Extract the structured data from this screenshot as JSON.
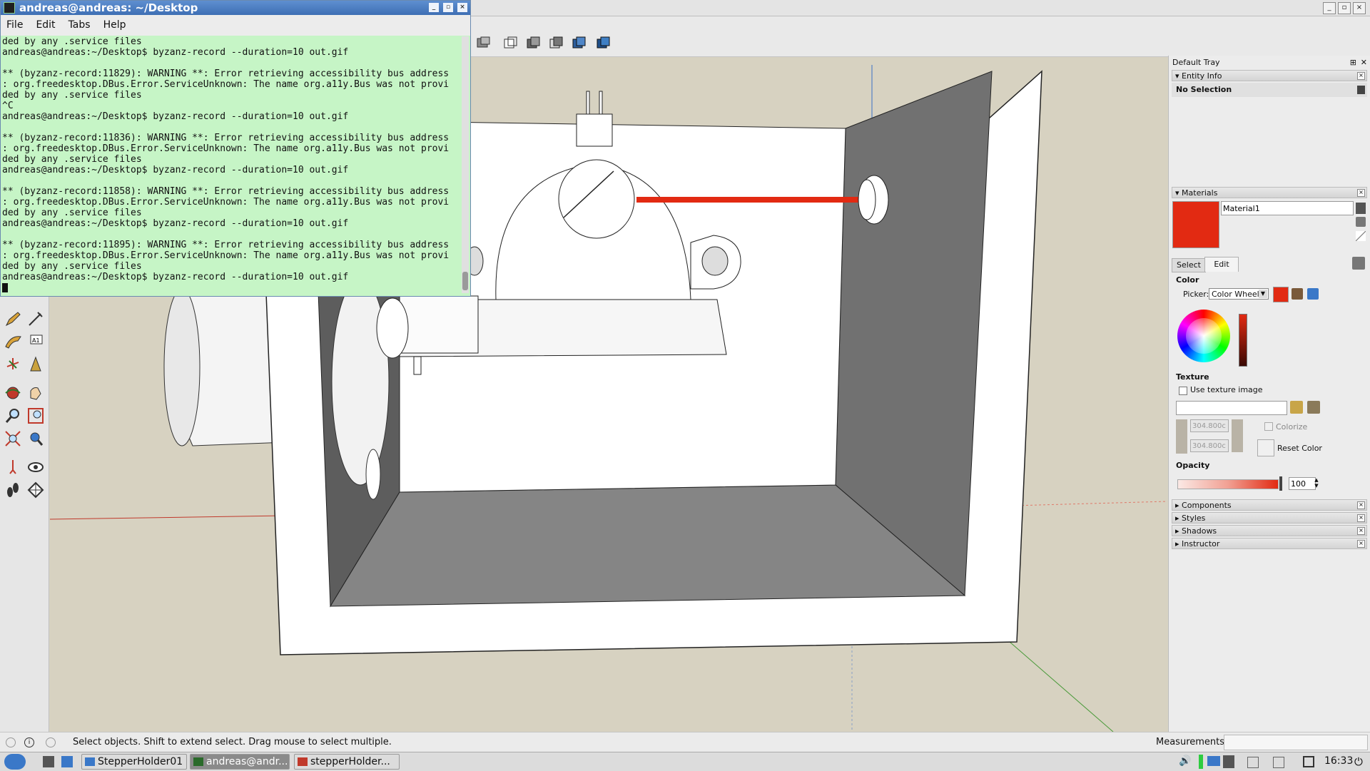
{
  "terminal": {
    "title": "andreas@andreas: ~/Desktop",
    "menu": [
      "File",
      "Edit",
      "Tabs",
      "Help"
    ],
    "lines": [
      "ded by any .service files",
      "andreas@andreas:~/Desktop$ byzanz-record --duration=10 out.gif",
      "",
      "** (byzanz-record:11829): WARNING **: Error retrieving accessibility bus address",
      ": org.freedesktop.DBus.Error.ServiceUnknown: The name org.a11y.Bus was not provi",
      "ded by any .service files",
      "^C",
      "andreas@andreas:~/Desktop$ byzanz-record --duration=10 out.gif",
      "",
      "** (byzanz-record:11836): WARNING **: Error retrieving accessibility bus address",
      ": org.freedesktop.DBus.Error.ServiceUnknown: The name org.a11y.Bus was not provi",
      "ded by any .service files",
      "andreas@andreas:~/Desktop$ byzanz-record --duration=10 out.gif",
      "",
      "** (byzanz-record:11858): WARNING **: Error retrieving accessibility bus address",
      ": org.freedesktop.DBus.Error.ServiceUnknown: The name org.a11y.Bus was not provi",
      "ded by any .service files",
      "andreas@andreas:~/Desktop$ byzanz-record --duration=10 out.gif",
      "",
      "** (byzanz-record:11895): WARNING **: Error retrieving accessibility bus address",
      ": org.freedesktop.DBus.Error.ServiceUnknown: The name org.a11y.Bus was not provi",
      "ded by any .service files",
      "andreas@andreas:~/Desktop$ byzanz-record --duration=10 out.gif"
    ]
  },
  "tray": {
    "title": "Default Tray",
    "entity_info": {
      "label": "Entity Info",
      "selection": "No Selection"
    },
    "materials": {
      "label": "Materials",
      "name": "Material1",
      "swatch_color": "#e22a12",
      "tabs": [
        "Select",
        "Edit"
      ],
      "color_label": "Color",
      "picker_label": "Picker:",
      "picker_value": "Color Wheel",
      "texture_label": "Texture",
      "use_texture": "Use texture image",
      "width": "304.800c",
      "height": "304.800c",
      "colorize": "Colorize",
      "reset_color": "Reset Color",
      "opacity_label": "Opacity",
      "opacity_value": "100"
    },
    "collapsed": [
      "Components",
      "Styles",
      "Shadows",
      "Instructor"
    ]
  },
  "status": {
    "hint": "Select objects. Shift to extend select. Drag mouse to select multiple.",
    "measurements_label": "Measurements"
  },
  "taskbar": {
    "tasks": [
      "StepperHolder01",
      "andreas@andr...",
      "stepperHolder..."
    ],
    "clock": "16:33"
  },
  "colors": {
    "accent_red": "#e22a12",
    "terminal_bg": "#c6f5c6"
  }
}
